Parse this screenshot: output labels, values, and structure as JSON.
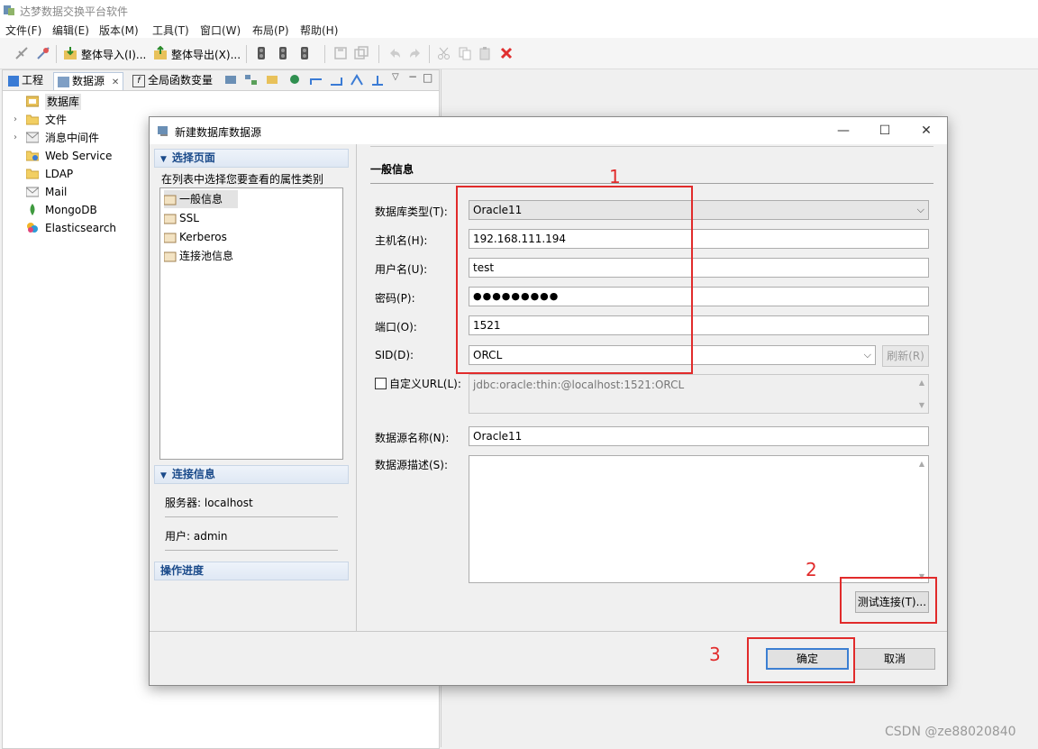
{
  "app": {
    "title": "达梦数据交换平台软件"
  },
  "menu": [
    "文件(F)",
    "编辑(E)",
    "版本(M)",
    "工具(T)",
    "窗口(W)",
    "布局(P)",
    "帮助(H)"
  ],
  "toolbar": {
    "import_label": "整体导入(I)...",
    "export_label": "整体导出(X)..."
  },
  "left_tabs": {
    "project": "工程",
    "datasource": "数据源",
    "close_mark": "✕",
    "globals": "全局函数变量"
  },
  "tree": [
    {
      "label": "数据库",
      "expandable": false,
      "selected": true,
      "icon": "database-icon"
    },
    {
      "label": "文件",
      "expandable": true,
      "icon": "folder-icon"
    },
    {
      "label": "消息中间件",
      "expandable": true,
      "icon": "message-icon"
    },
    {
      "label": "Web Service",
      "expandable": false,
      "icon": "web-service-icon"
    },
    {
      "label": "LDAP",
      "expandable": false,
      "icon": "ldap-icon"
    },
    {
      "label": "Mail",
      "expandable": false,
      "icon": "mail-icon"
    },
    {
      "label": "MongoDB",
      "expandable": false,
      "icon": "mongodb-icon"
    },
    {
      "label": "Elasticsearch",
      "expandable": false,
      "icon": "elasticsearch-icon"
    }
  ],
  "dialog": {
    "title": "新建数据库数据源",
    "select_page": {
      "header": "选择页面",
      "hint": "在列表中选择您要查看的属性类别",
      "pages": [
        "一般信息",
        "SSL",
        "Kerberos",
        "连接池信息"
      ]
    },
    "connection": {
      "header": "连接信息",
      "server": "服务器: localhost",
      "user": "用户: admin"
    },
    "progress_header": "操作进度",
    "general": {
      "section_title": "一般信息",
      "db_type_label": "数据库类型(T):",
      "db_type_value": "Oracle11",
      "host_label": "主机名(H):",
      "host_value": "192.168.111.194",
      "username_label": "用户名(U):",
      "username_value": "test",
      "password_label": "密码(P):",
      "password_value": "●●●●●●●●●",
      "port_label": "端口(O):",
      "port_value": "1521",
      "sid_label": "SID(D):",
      "sid_value": "ORCL",
      "refresh_label": "刷新(R)",
      "custom_url_label": "自定义URL(L):",
      "custom_url_value": "jdbc:oracle:thin:@localhost:1521:ORCL",
      "ds_name_label": "数据源名称(N):",
      "ds_name_value": "Oracle11",
      "ds_desc_label": "数据源描述(S):",
      "ds_desc_value": "",
      "test_label": "测试连接(T)..."
    },
    "ok_label": "确定",
    "cancel_label": "取消"
  },
  "annotations": [
    "1",
    "2",
    "3"
  ],
  "watermark": "CSDN @ze88020840",
  "colors": {
    "annotation_red": "#e12b2b",
    "header_blue": "#1a4a8a",
    "default_button_border": "#3c7fd2"
  }
}
